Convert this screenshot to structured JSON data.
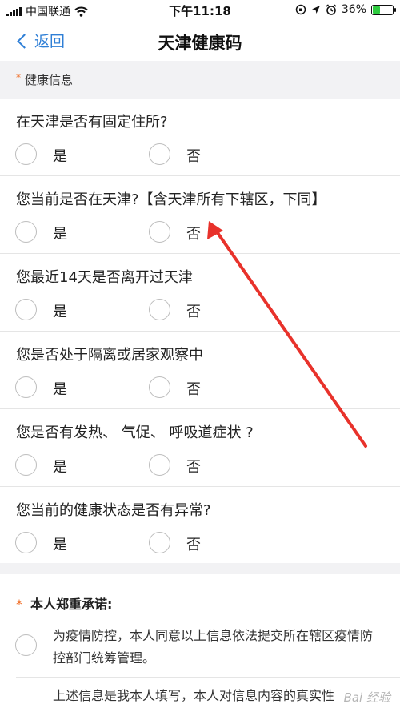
{
  "status_bar": {
    "carrier": "中国联通",
    "time": "下午11:18",
    "battery_percent": "36%",
    "battery_level": 0.36
  },
  "nav": {
    "back_label": "返回",
    "title": "天津健康码"
  },
  "section": {
    "required_mark": "*",
    "title": "健康信息"
  },
  "questions": [
    {
      "text": "在天津是否有固定住所?",
      "yes": "是",
      "no": "否"
    },
    {
      "text": "您当前是否在天津?【含天津所有下辖区，下同】",
      "yes": "是",
      "no": "否"
    },
    {
      "text": "您最近14天是否离开过天津",
      "yes": "是",
      "no": "否"
    },
    {
      "text": "您是否处于隔离或居家观察中",
      "yes": "是",
      "no": "否"
    },
    {
      "text": "您是否有发热、 气促、 呼吸道症状 ?",
      "yes": "是",
      "no": "否"
    },
    {
      "text": "您当前的健康状态是否有异常?",
      "yes": "是",
      "no": "否"
    }
  ],
  "pledge": {
    "required_mark": "*",
    "title": "本人郑重承诺:",
    "item1": "为疫情防控，本人同意以上信息依法提交所在辖区疫情防控部门统筹管理。",
    "item2": "上述信息是我本人填写，本人对信息内容的真实性"
  },
  "annotation": {
    "color": "#e8322b"
  },
  "watermark": "Bai 经验"
}
